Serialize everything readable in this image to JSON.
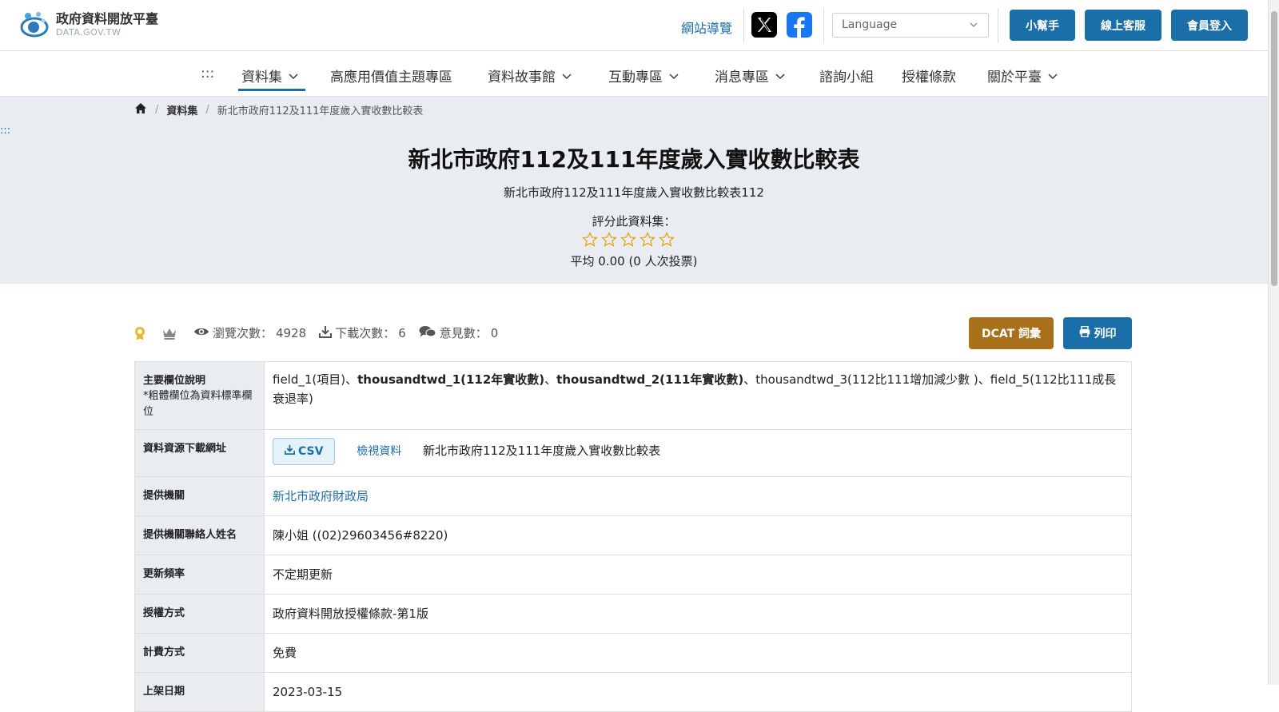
{
  "header": {
    "logo_title": "政府資料開放平臺",
    "logo_sub": "DATA.GOV.TW",
    "sitemap": "網站導覽",
    "language_placeholder": "Language",
    "btn_helper": "小幫手",
    "btn_service": "線上客服",
    "btn_login": "會員登入"
  },
  "nav": {
    "accesskey": ":::",
    "items": [
      "資料集",
      "高應用價值主題專區",
      "資料故事館",
      "互動專區",
      "消息專區",
      "諮詢小組",
      "授權條款",
      "關於平臺"
    ]
  },
  "breadcrumb": {
    "level1": "資料集",
    "current": "新北市政府112及111年度歲入實收數比較表"
  },
  "hero": {
    "skip": ":::",
    "title": "新北市政府112及111年度歲入實收數比較表",
    "subtitle": "新北市政府112及111年度歲入實收數比較表112",
    "rate_label": "評分此資料集：",
    "rating": 0,
    "avg_text": "平均 0.00 (0 人次投票)"
  },
  "stats": {
    "views_label": "瀏覽次數：",
    "views": "4928",
    "downloads_label": "下載次數：",
    "downloads": "6",
    "comments_label": "意見數：",
    "comments": "0",
    "dcat_button": "DCAT 詞彙",
    "print_button": "列印"
  },
  "meta": {
    "fields_label": "主要欄位說明",
    "fields_note": "*粗體欄位為資料標準欄位",
    "fields_parts": {
      "p1": "field_1(項目)、",
      "b1": "thousandtwd_1(112年實收數)",
      "p2": "、",
      "b2": "thousandtwd_2(111年實收數)",
      "p3": "、thousandtwd_3(112比111增加減少數 )、field_5(112比111成長衰退率)"
    },
    "download_label": "資料資源下載網址",
    "csv_button": "CSV",
    "view_data": "檢視資料",
    "resource_name": "新北市政府112及111年度歲入實收數比較表",
    "agency_label": "提供機關",
    "agency": "新北市政府財政局",
    "contact_label": "提供機關聯絡人姓名",
    "contact": "陳小姐 ((02)29603456#8220)",
    "freq_label": "更新頻率",
    "freq": "不定期更新",
    "license_label": "授權方式",
    "license": "政府資料開放授權條款-第1版",
    "fee_label": "計費方式",
    "fee": "免費",
    "date_label": "上架日期",
    "date": "2023-03-15"
  }
}
